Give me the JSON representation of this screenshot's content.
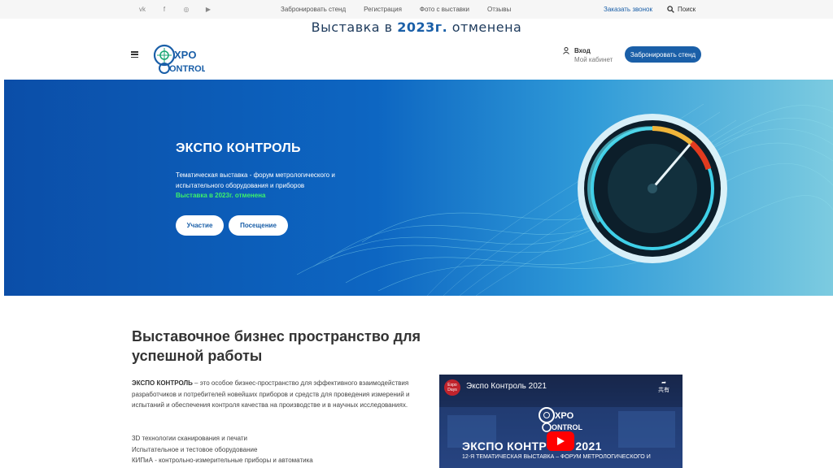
{
  "topbar": {
    "social": [
      {
        "icon": "vk-icon",
        "glyph": "vk"
      },
      {
        "icon": "facebook-icon",
        "glyph": "f"
      },
      {
        "icon": "instagram-icon",
        "glyph": "◎"
      },
      {
        "icon": "youtube-icon",
        "glyph": "▶"
      }
    ],
    "nav": [
      "Забронировать стенд",
      "Регистрация",
      "Фото с выставки",
      "Отзывы"
    ],
    "callback": "Заказать звонок",
    "search": "Поиск"
  },
  "announce": {
    "before": "Выставка в ",
    "year": "2023г.",
    "after": " отменена"
  },
  "header": {
    "logo_top": "XPO",
    "logo_bottom": "ONTROL",
    "login_label": "Вход",
    "login_sub": "Мой кабинет",
    "book_button": "Забронировать стенд"
  },
  "hero": {
    "title": "ЭКСПО КОНТРОЛЬ",
    "description": "Тематическая выставка - форум метрологического и испытательного оборудования и приборов",
    "cancel_note": "Выставка в 2023г. отменена",
    "btn_participation": "Участие",
    "btn_visit": "Посещение"
  },
  "content": {
    "heading": "Выставочное бизнес пространство для успешной работы",
    "intro_brand": "ЭКСПО КОНТРОЛЬ",
    "intro_text": " – это особое бизнес-пространство для эффективного взаимодействия разработчиков и потребителей новейших приборов и средств для проведения измерений и испытаний и обеспечения контроля качества на производстве и в научных исследованиях.",
    "list": [
      "3D технологии сканирования и печати",
      "Испытательное и тестовое оборудование",
      "КИПиА - контрольно-измерительные приборы и автоматика"
    ]
  },
  "video": {
    "channel": "Expo Days",
    "title": "Экспо Контроль 2021",
    "share": "共有",
    "logo_top": "XPO",
    "logo_bottom": "ONTROL",
    "big_text": "ЭКСПО КОНТРОЛЬ 2021",
    "sub_text": "12-Я ТЕМАТИЧЕСКАЯ ВЫСТАВКА – ФОРУМ МЕТРОЛОГИЧЕСКОГО И"
  },
  "colors": {
    "accent": "#1a5fa8",
    "cancel_green": "#3df26a"
  }
}
